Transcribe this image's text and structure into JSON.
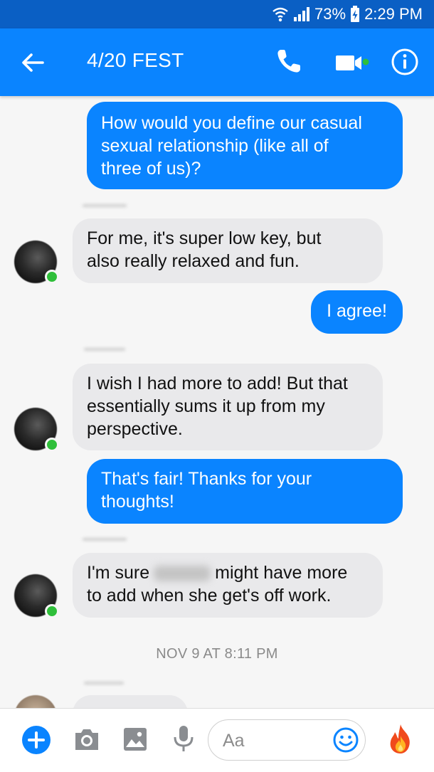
{
  "status_bar": {
    "battery": "73%",
    "time": "2:29 PM"
  },
  "header": {
    "title": "4/20 FEST"
  },
  "messages": [
    {
      "direction": "out",
      "lines": [
        "How would you define our casual",
        "sexual relationship (like all of",
        "three of us)?"
      ]
    },
    {
      "direction": "in",
      "lines": [
        "For me, it's super low key, but",
        "also really relaxed and fun."
      ]
    },
    {
      "direction": "out",
      "lines": [
        "I agree!"
      ]
    },
    {
      "direction": "in",
      "lines": [
        "I wish I had more to add! But that",
        "essentially sums it up from my",
        "perspective."
      ]
    },
    {
      "direction": "out",
      "lines": [
        "That's fair! Thanks for your",
        "thoughts!"
      ]
    },
    {
      "direction": "in",
      "lines": [
        "I'm sure",
        "might have more",
        "to add when she get's off work."
      ]
    }
  ],
  "timestamp": "NOV 9 AT 8:11 PM",
  "composer": {
    "placeholder": "Aa"
  },
  "colors": {
    "accent": "#0a84ff",
    "status_bar": "#0a5fc4",
    "online": "#2fbf3a",
    "incoming_bubble": "#e9e9eb"
  },
  "icons": [
    "back-arrow-icon",
    "phone-icon",
    "video-camera-icon",
    "info-icon",
    "plus-icon",
    "camera-icon",
    "gallery-icon",
    "microphone-icon",
    "emoji-icon",
    "fire-icon"
  ]
}
